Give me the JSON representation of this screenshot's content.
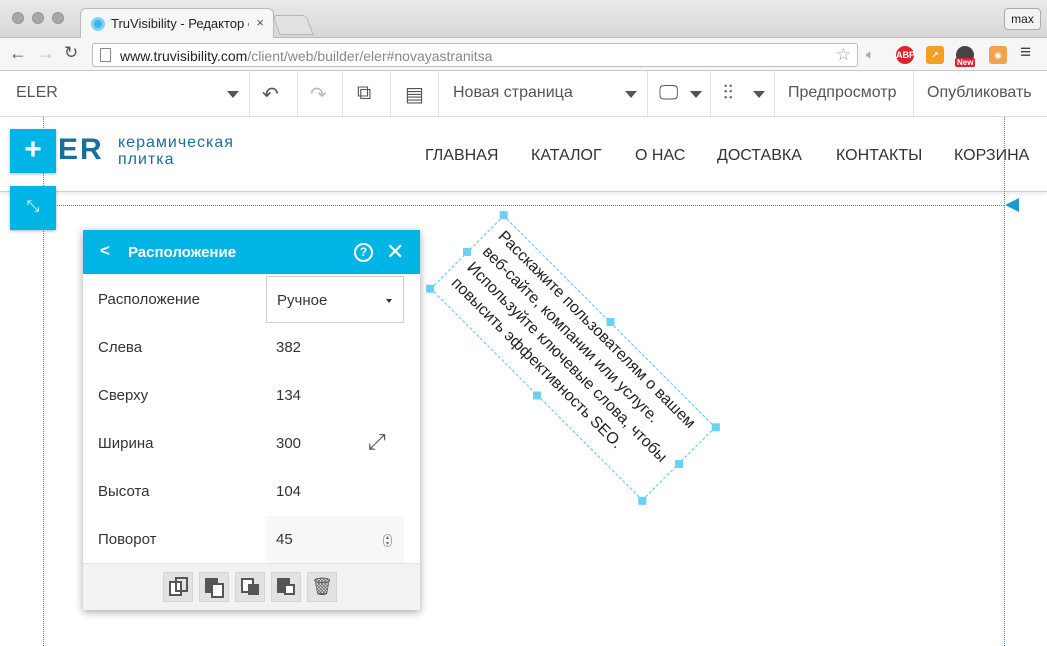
{
  "browser": {
    "tab_title": "TruVisibility - Редактор са",
    "tab_close": "×",
    "profile": "max",
    "url_prefix": "www.truvisibility.com",
    "url_path": "/client/web/builder/eler#novayastranitsa",
    "ext_abp": "ABP",
    "ext_new": "New"
  },
  "toolbar": {
    "site_name": "ELER",
    "page_name": "Новая страница",
    "preview": "Предпросмотр",
    "publish": "Опубликовать"
  },
  "site": {
    "logo_mark": "ER",
    "logo_line1": "керамическая",
    "logo_line2": "плитка",
    "nav": [
      "ГЛАВНАЯ",
      "КАТАЛОГ",
      "О НАС",
      "ДОСТАВКА",
      "КОНТАКТЫ",
      "КОРЗИНА"
    ]
  },
  "panel": {
    "back": "<",
    "title": "Расположение",
    "help": "?",
    "close": "✕",
    "rows": [
      {
        "label": "Расположение",
        "value": "Ручное"
      },
      {
        "label": "Слева",
        "value": "382"
      },
      {
        "label": "Сверху",
        "value": "134"
      },
      {
        "label": "Ширина",
        "value": "300"
      },
      {
        "label": "Высота",
        "value": "104"
      },
      {
        "label": "Поворот",
        "value": "45"
      }
    ]
  },
  "text_block": {
    "content": "Расскажите пользователям о вашем веб-сайте, компании или услуге. Используйте ключевые слова, чтобы повысить эффективность SEO."
  },
  "colors": {
    "accent": "#00b4e6",
    "logo": "#1a6d9e",
    "guide": "#3a8fc8"
  }
}
